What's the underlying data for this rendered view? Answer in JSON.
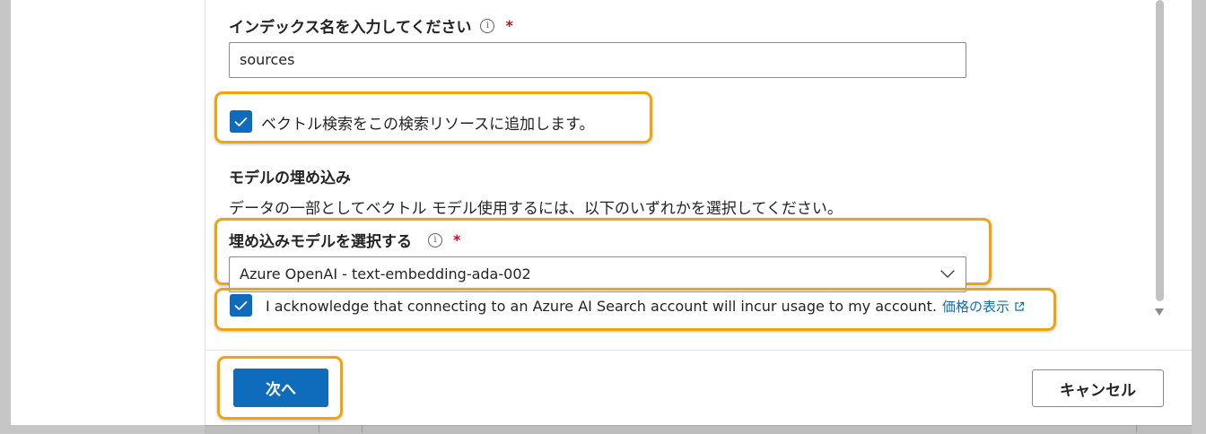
{
  "index_name": {
    "label": "インデックス名を入力してください",
    "required_mark": "*",
    "info_glyph": "i",
    "value": "sources"
  },
  "vector_search": {
    "checked": true,
    "label": "ベクトル検索をこの検索リソースに追加します。"
  },
  "embedding_section": {
    "title": "モデルの埋め込み",
    "description": "データの一部としてベクトル モデル使用するには、以下のいずれかを選択してください。"
  },
  "embedding_model": {
    "label": "埋め込みモデルを選択する",
    "required_mark": "*",
    "info_glyph": "i",
    "selected": "Azure OpenAI - text-embedding-ada-002"
  },
  "acknowledge": {
    "checked": true,
    "text": "I acknowledge that connecting to an Azure AI Search account will incur usage to my account.",
    "link_label": "価格の表示"
  },
  "footer": {
    "next_label": "次へ",
    "cancel_label": "キャンセル"
  },
  "colors": {
    "accent": "#0f6cbd",
    "highlight": "#f0a30a",
    "required": "#c50f1f"
  }
}
